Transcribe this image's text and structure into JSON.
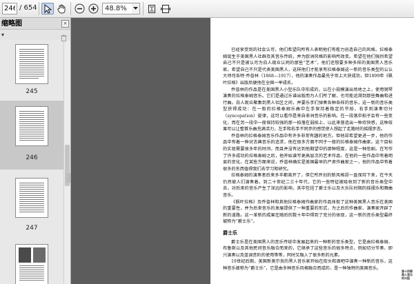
{
  "toolbar": {
    "current_page": "246",
    "page_total": "/ 654",
    "zoom": "48.8%"
  },
  "icons": {
    "select": "cursor-arrow",
    "hand": "hand",
    "zoom_out": "minus-circle",
    "zoom_in": "plus-circle",
    "fit_page": "fit-page",
    "fit_width": "fit-width"
  },
  "sidebar": {
    "title": "缩略图",
    "close_glyph": "×",
    "thumbnails": [
      {
        "label": "245"
      },
      {
        "label": "246"
      },
      {
        "label": "247"
      }
    ]
  },
  "document": {
    "paragraphs": [
      "已经享受到的社会认可，他们希望向所有人表明他们有能力创造自己的风格。拉格泰姆诞生于美国黑人社群及其音乐传统，并为欧洲风格的影响所改变。希望在他们强烈希望自己不只是被认可为白人观众认同的那些“艺术”，他们还想要多种多样的美国黑人音乐家。希望自己不只是代表美国黑人，这样他们才能享有拉格泰姆这一新的音乐类型的公认大师司各特·乔普林（1868—1917），他的演奏作品最先于世上大获成功，但1899年《枫叶拉格》出版后便他在全国一举成名。",
      "乔普林的作品是在美国黑人小型乐队中形成的，以在小规模演出场地之上，使用钢琴演奏的拉格泰姆音乐。它们是通过乐谱出版而为人们所了解，也可能追溯到那些舞曲和进行曲。白人观众聚集到黑人社区之间，并要乐手们弹奏各种各样的音乐，这一新的音乐类型获得成功：在一般的拉格泰姆乐曲中左手保持着稳定的节拍，右手则演奏切分（syncopation）旋律，这可以看作是来自非洲音乐的影响。在一段落中拍子会有一些变化，而在另一段中一般保持较强的那一拍落在弱拍上，以此来营造出一种欢快感，这种效果可以让整首乐曲充满活力，左手和右手不同步的感觉使人想起了走路时的摇摆步态。",
      "乔普林的拉格泰姆音乐作品中有许多非常有趣的地方。但他却希望更进一步，他的作品中有着一种对古典音乐的追求，他在很多方面不同于一般的拉格泰姆作曲家。这个目标的实现需要很多年的时间，而且并没有达到他期望中的那种程度，这是一种悲剧。在写作了许多成功的拉格泰姆之后，他开始谱写更高层次的艺术作品，在他的一些作品中有着明显的变化，在某些方面来说，乔普林确实是美国最早的严肃作曲家之一，他的作品中有着很多的东西值得我们去学习和研究。",
      "拉格泰姆的演奏者后来多半都离开了，但它所开创的新风格却一直保持下来，在今天仍然被人们演奏着。到二十世纪二三十年代，它的一些特征被吸收到了新的音乐类型中去，对后来的音乐产生了深远的影响，其中包括了爵士乐以及大乐队时期的摇摆乐和舞曲音乐。",
      "《枫叶拉格》及乔普林和其他拉格泰姆作曲家的作品体现了这种美国黑人音乐在美国的重要性，并为后来音乐的发展提供了一种重要的形式，为之后的作曲家、演奏家开辟了新的道路。这一革新的成果在随后的数十年中得到了充分的体现，这一新的音乐类型最终被称为“爵士乐”。"
    ],
    "heading": "爵士乐",
    "paragraphs_after": [
      "爵士乐是在美国黑人的音乐传统中发展起来的一种新的音乐类型，它是由拉格泰姆、布鲁斯以及其他民间音乐融合而来的，它继承了这些音乐的很多特点，例如切分节奏、即兴演奏以及蓝调音阶的使用等等，同时又融入了很多新的元素。",
      "19世纪后期，美国新奥尔良的黑人音乐家开始在街头和酒吧中演奏一种新的音乐，这种音乐被称为“爵士乐”，它是由多种音乐风格融合而成的，是一种独特的美国音乐。"
    ],
    "edge_note": "第十四章 黑人音乐的兴起"
  }
}
